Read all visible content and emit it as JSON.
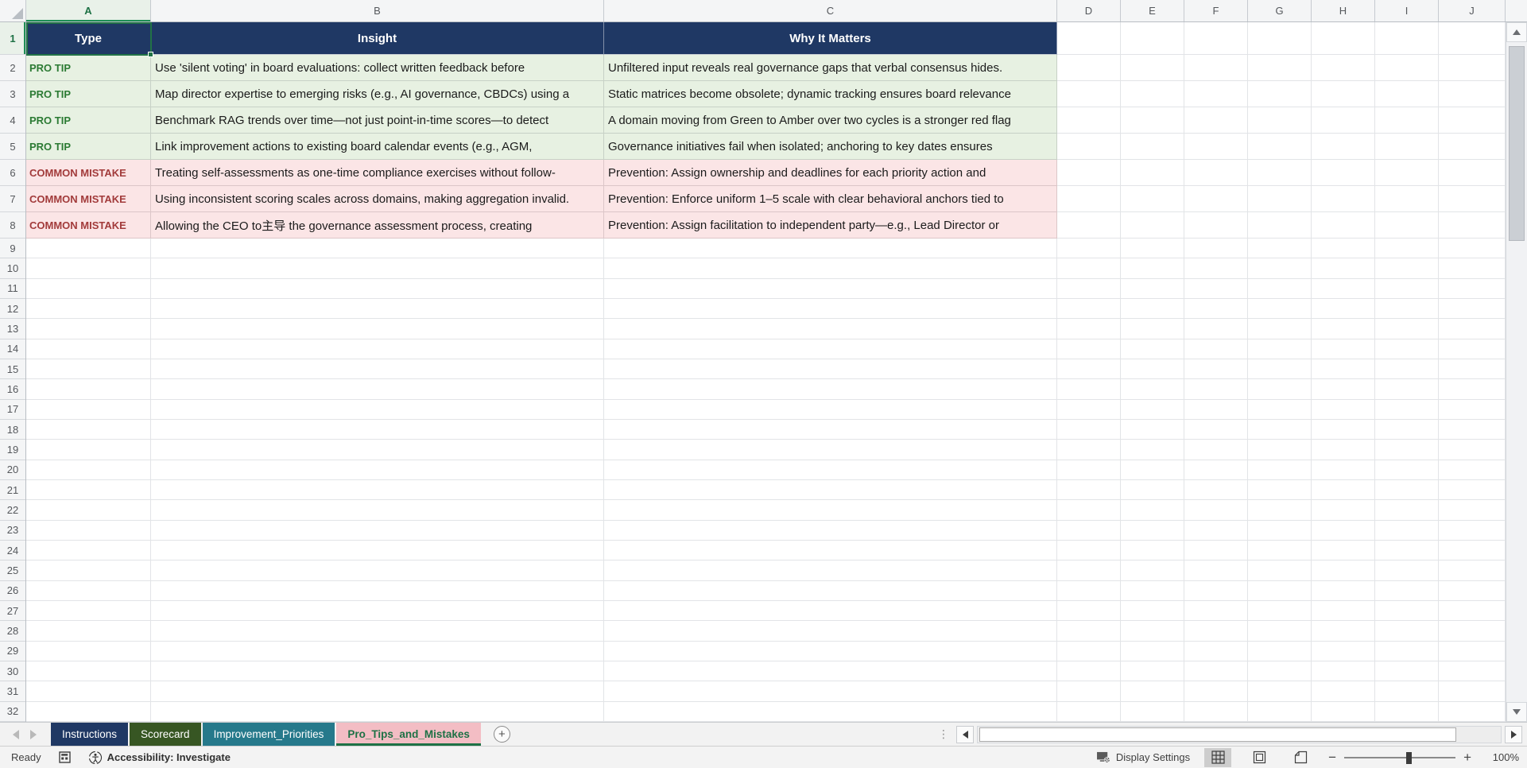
{
  "grid": {
    "selected_cell": "A1",
    "column_letters": [
      "A",
      "B",
      "C",
      "D",
      "E",
      "F",
      "G",
      "H",
      "I",
      "J"
    ],
    "row_count": 32,
    "header_row": [
      "Type",
      "Insight",
      "Why It Matters"
    ],
    "rows": [
      {
        "type": "PRO TIP",
        "insight": "Use 'silent voting' in board evaluations: collect written feedback before",
        "why": "Unfiltered input reveals real governance gaps that verbal consensus hides."
      },
      {
        "type": "PRO TIP",
        "insight": "Map director expertise to emerging risks (e.g., AI governance, CBDCs) using a",
        "why": "Static matrices become obsolete; dynamic tracking ensures board relevance"
      },
      {
        "type": "PRO TIP",
        "insight": "Benchmark RAG trends over time—not just point-in-time scores—to detect",
        "why": "A domain moving from Green to Amber over two cycles is a stronger red flag"
      },
      {
        "type": "PRO TIP",
        "insight": "Link improvement actions to existing board calendar events (e.g., AGM,",
        "why": "Governance initiatives fail when isolated; anchoring to key dates ensures"
      },
      {
        "type": "COMMON MISTAKE",
        "insight": "Treating self-assessments as one-time compliance exercises without follow-",
        "why": "Prevention: Assign ownership and deadlines for each priority action and"
      },
      {
        "type": "COMMON MISTAKE",
        "insight": "Using inconsistent scoring scales across domains, making aggregation invalid.",
        "why": "Prevention: Enforce uniform 1–5 scale with clear behavioral anchors tied to"
      },
      {
        "type": "COMMON MISTAKE",
        "insight": "Allowing the CEO to主导 the governance assessment process, creating",
        "why": "Prevention: Assign facilitation to independent party—e.g., Lead Director or"
      }
    ]
  },
  "colors": {
    "header_fill": "#1F3864",
    "header_text": "#FFFFFF",
    "protip_fill": "#E7F1E2",
    "protip_text": "#2B7A33",
    "mistake_fill": "#FBE5E6",
    "mistake_text": "#A23B3B",
    "selection_green": "#217346",
    "tab_active_fill": "#F3BDC4",
    "tab_active_text": "#1E7145"
  },
  "tabs": {
    "items": [
      {
        "label": "Instructions",
        "color": "#1F3864",
        "active": false
      },
      {
        "label": "Scorecard",
        "color": "#375623",
        "active": false
      },
      {
        "label": "Improvement_Priorities",
        "color": "#26798B",
        "active": false
      },
      {
        "label": "Pro_Tips_and_Mistakes",
        "color": "#F3BDC4",
        "active": true
      }
    ],
    "new_sheet_label": "+"
  },
  "status_bar": {
    "ready": "Ready",
    "accessibility": "Accessibility: Investigate",
    "display_settings": "Display Settings",
    "zoom_level": "100%",
    "zoom_minus": "−",
    "zoom_plus": "+"
  }
}
